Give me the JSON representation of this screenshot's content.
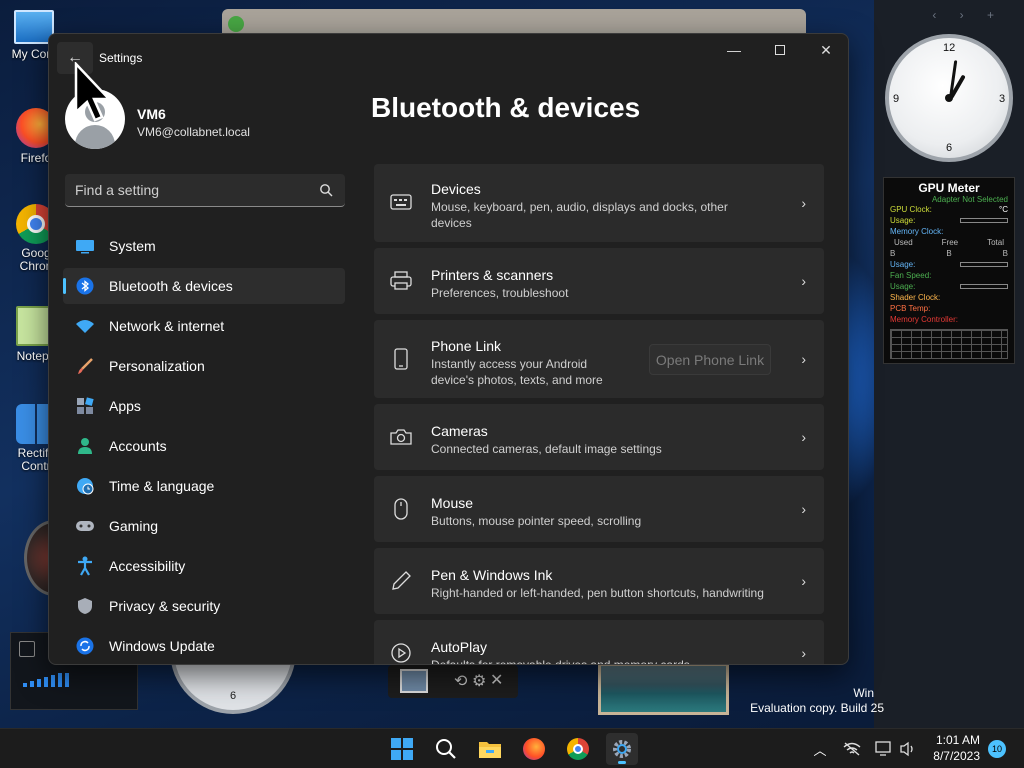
{
  "desktop": {
    "icons": [
      {
        "label": "My Com"
      },
      {
        "label": "Firefo"
      },
      {
        "label": "Goog Chron"
      },
      {
        "label": "Notepa"
      },
      {
        "label": "Rectify Contr"
      }
    ],
    "watermark": {
      "line1": "Win",
      "line2": "Evaluation copy. Build 25"
    },
    "widgets": {
      "clock2_label": "6"
    }
  },
  "gadgets": {
    "clock": {
      "n12": "12",
      "n3": "3",
      "n6": "6",
      "n9": "9"
    },
    "gpu": {
      "title": "GPU Meter",
      "adapter": "Adapter Not Selected",
      "gpu_clock": "GPU Clock:",
      "celsius": "°C",
      "usage": "Usage:",
      "memory_clock": "Memory Clock:",
      "used": "Used",
      "free": "Free",
      "total": "Total",
      "b": "B",
      "fan_speed": "Fan Speed:",
      "shader_clock": "Shader Clock:",
      "pcb_temp": "PCB Temp:",
      "memory_controller": "Memory Controller:"
    }
  },
  "settings": {
    "app_title": "Settings",
    "back_label": "←",
    "user": {
      "name": "VM6",
      "email": "VM6@collabnet.local"
    },
    "search": {
      "placeholder": "Find a setting"
    },
    "nav": [
      {
        "label": "System",
        "icon": "monitor-icon"
      },
      {
        "label": "Bluetooth & devices",
        "icon": "bluetooth-icon",
        "active": true
      },
      {
        "label": "Network & internet",
        "icon": "wifi-icon"
      },
      {
        "label": "Personalization",
        "icon": "brush-icon"
      },
      {
        "label": "Apps",
        "icon": "apps-icon"
      },
      {
        "label": "Accounts",
        "icon": "person-icon"
      },
      {
        "label": "Time & language",
        "icon": "globe-clock-icon"
      },
      {
        "label": "Gaming",
        "icon": "gamepad-icon"
      },
      {
        "label": "Accessibility",
        "icon": "accessibility-icon"
      },
      {
        "label": "Privacy & security",
        "icon": "shield-icon"
      },
      {
        "label": "Windows Update",
        "icon": "update-icon"
      }
    ],
    "page_title": "Bluetooth & devices",
    "cards": [
      {
        "title": "Devices",
        "desc": "Mouse, keyboard, pen, audio, displays and docks, other devices",
        "icon": "devices-icon"
      },
      {
        "title": "Printers & scanners",
        "desc": "Preferences, troubleshoot",
        "icon": "printer-icon"
      },
      {
        "title": "Phone Link",
        "desc": "Instantly access your Android device's photos, texts, and more",
        "icon": "phone-icon",
        "button": "Open Phone Link"
      },
      {
        "title": "Cameras",
        "desc": "Connected cameras, default image settings",
        "icon": "camera-icon"
      },
      {
        "title": "Mouse",
        "desc": "Buttons, mouse pointer speed, scrolling",
        "icon": "mouse-icon"
      },
      {
        "title": "Pen & Windows Ink",
        "desc": "Right-handed or left-handed, pen button shortcuts, handwriting",
        "icon": "pen-icon"
      },
      {
        "title": "AutoPlay",
        "desc": "Defaults for removable drives and memory cards",
        "icon": "autoplay-icon"
      }
    ]
  },
  "taskbar": {
    "time": "1:01 AM",
    "date": "8/7/2023",
    "notifications": "10"
  },
  "colors": {
    "accent": "#4cc2ff",
    "window_bg": "#202020",
    "card_bg": "#2b2b2b"
  }
}
